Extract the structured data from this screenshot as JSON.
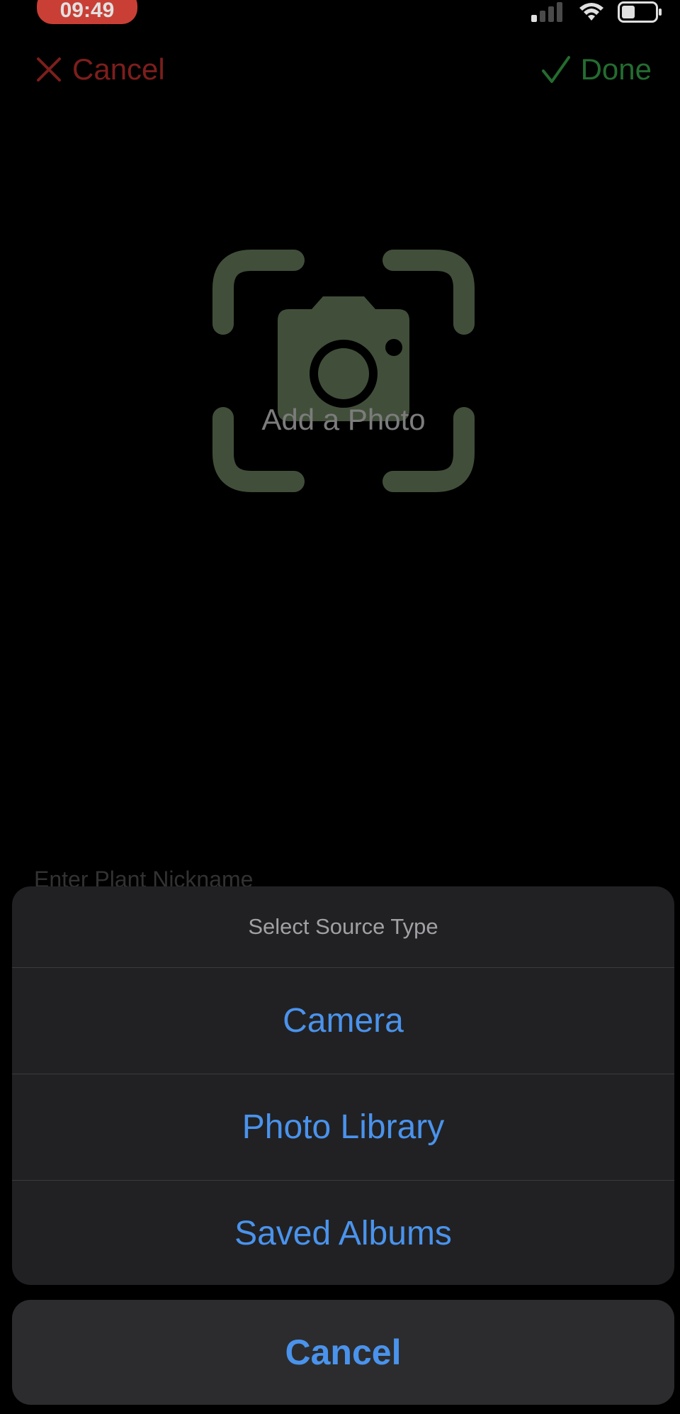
{
  "status_bar": {
    "time": "09:49",
    "icons": [
      "signal-icon",
      "wifi-icon",
      "battery-icon"
    ]
  },
  "nav": {
    "cancel_label": "Cancel",
    "done_label": "Done",
    "cancel_color": "#8f2320",
    "done_color": "#2a7b37"
  },
  "photo": {
    "label": "Add a Photo",
    "icon": "camera-viewfinder-icon",
    "icon_color": "#4a5a42"
  },
  "form": {
    "nickname_placeholder": "Enter Plant Nickname"
  },
  "action_sheet": {
    "title": "Select Source Type",
    "options": [
      {
        "label": "Camera"
      },
      {
        "label": "Photo Library"
      },
      {
        "label": "Saved Albums"
      }
    ],
    "cancel_label": "Cancel",
    "accent_color": "#4a93ec"
  }
}
